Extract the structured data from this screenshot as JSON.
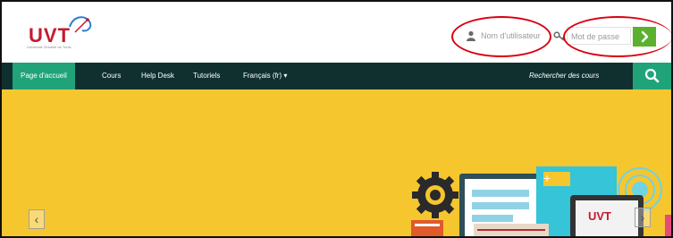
{
  "header": {
    "logo": {
      "text": "UVT",
      "tagline": "Université Virtuelle de Tunis"
    },
    "login": {
      "username_placeholder": "Nom d'utilisateur",
      "password_placeholder": "Mot de passe",
      "submit_icon": "chevron-right-icon"
    }
  },
  "nav": {
    "items": [
      {
        "label": "Page d'accueil",
        "active": true
      },
      {
        "label": "Cours"
      },
      {
        "label": "Help Desk"
      },
      {
        "label": "Tutoriels"
      },
      {
        "label": "Français (fr) ▾"
      }
    ],
    "search_label": "Rechercher des cours",
    "search_icon": "search-icon"
  },
  "hero": {
    "prev_arrow": "‹",
    "next_arrow": "›",
    "illustration_logo": "UVT"
  },
  "colors": {
    "nav_bg": "#10302f",
    "accent": "#21a37a",
    "hero_bg": "#f6c62f",
    "login_button": "#5bb12f",
    "annotation": "#d9000f",
    "logo": "#c41a30"
  }
}
